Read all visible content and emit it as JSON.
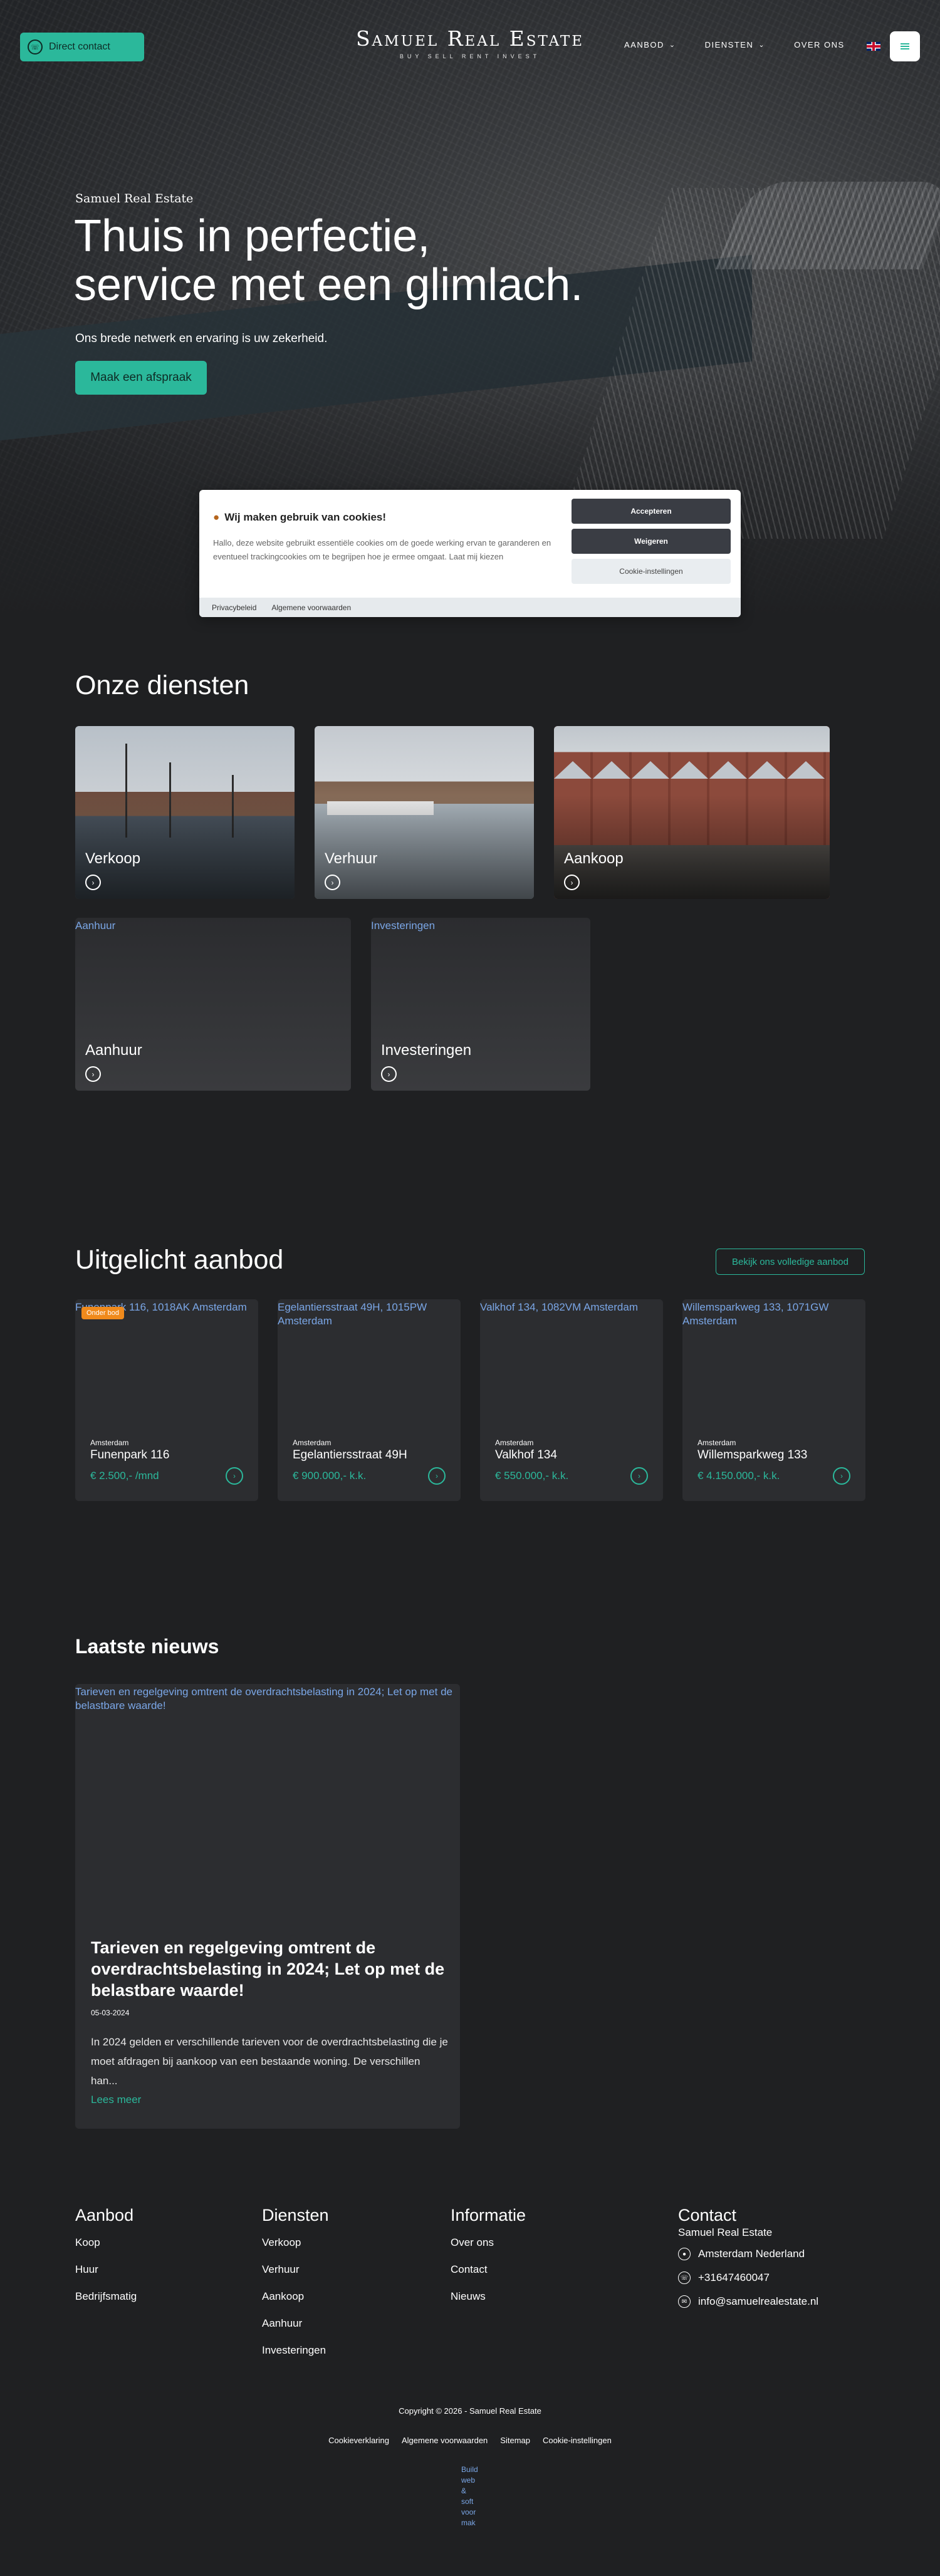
{
  "header": {
    "direct_contact": "Direct contact",
    "logo_main": "Samuel Real Estate",
    "logo_sub": "BUY SELL RENT INVEST",
    "nav": [
      {
        "label": "AANBOD"
      },
      {
        "label": "DIENSTEN"
      },
      {
        "label": "OVER ONS"
      }
    ]
  },
  "hero": {
    "kicker": "Samuel Real Estate",
    "title_line1": "Thuis in perfectie,",
    "title_line2": "service met een glimlach.",
    "subtitle": "Ons brede netwerk en ervaring is uw zekerheid.",
    "cta": "Maak een afspraak"
  },
  "cookie": {
    "title": "Wij maken gebruik van cookies!",
    "text": "Hallo, deze website gebruikt essentiële cookies om de goede werking ervan te garanderen en eventueel trackingcookies om te begrijpen hoe je ermee omgaat. Laat mij kiezen",
    "accept": "Accepteren",
    "refuse": "Weigeren",
    "settings": "Cookie-instellingen",
    "privacy": "Privacybeleid",
    "terms": "Algemene voorwaarden"
  },
  "services": {
    "title": "Onze diensten",
    "cards": [
      {
        "label": "Verkoop"
      },
      {
        "label": "Verhuur"
      },
      {
        "label": "Aankoop"
      },
      {
        "label": "Aanhuur",
        "alt": "Aanhuur"
      },
      {
        "label": "Investeringen",
        "alt": "Investeringen"
      }
    ]
  },
  "featured": {
    "title": "Uitgelicht aanbod",
    "all_button": "Bekijk ons volledige aanbod",
    "properties": [
      {
        "alt": "Funenpark 116, 1018AK Amsterdam",
        "badge": "Onder bod",
        "city": "Amsterdam",
        "street": "Funenpark 116",
        "price": "€ 2.500,- /mnd"
      },
      {
        "alt": "Egelantiersstraat 49H, 1015PW Amsterdam",
        "city": "Amsterdam",
        "street": "Egelantiersstraat 49H",
        "price": "€ 900.000,- k.k."
      },
      {
        "alt": "Valkhof 134, 1082VM Amsterdam",
        "city": "Amsterdam",
        "street": "Valkhof 134",
        "price": "€ 550.000,- k.k."
      },
      {
        "alt": "Willemsparkweg 133, 1071GW Amsterdam",
        "city": "Amsterdam",
        "street": "Willemsparkweg 133",
        "price": "€ 4.150.000,- k.k."
      }
    ]
  },
  "news": {
    "title": "Laatste nieuws",
    "alt": "Tarieven en regelgeving omtrent de overdrachtsbelasting in 2024; Let op met de belastbare waarde!",
    "headline": "Tarieven en regelgeving omtrent de overdrachtsbelasting in 2024; Let op met de belastbare waarde!",
    "date": "05-03-2024",
    "excerpt": "In 2024 gelden er verschillende tarieven voor de overdrachtsbelasting die je moet afdragen bij aankoop van een bestaande woning. De verschillen han...",
    "more": "Lees meer"
  },
  "footer": {
    "aanbod": {
      "title": "Aanbod",
      "links": [
        "Koop",
        "Huur",
        "Bedrijfsmatig"
      ]
    },
    "diensten": {
      "title": "Diensten",
      "links": [
        "Verkoop",
        "Verhuur",
        "Aankoop",
        "Aanhuur",
        "Investeringen"
      ]
    },
    "informatie": {
      "title": "Informatie",
      "links": [
        "Over ons",
        "Contact",
        "Nieuws"
      ]
    },
    "contact": {
      "title": "Contact",
      "company": "Samuel Real Estate",
      "address": "Amsterdam Nederland",
      "phone": "+31647460047",
      "email": "info@samuelrealestate.nl"
    },
    "copyright": "Copyright © 2026 - Samuel Real Estate",
    "legal": [
      "Cookieverklaring",
      "Algemene voorwaarden",
      "Sitemap",
      "Cookie-instellingen"
    ],
    "webdesign_alt": "Build web & soft voor mak"
  }
}
